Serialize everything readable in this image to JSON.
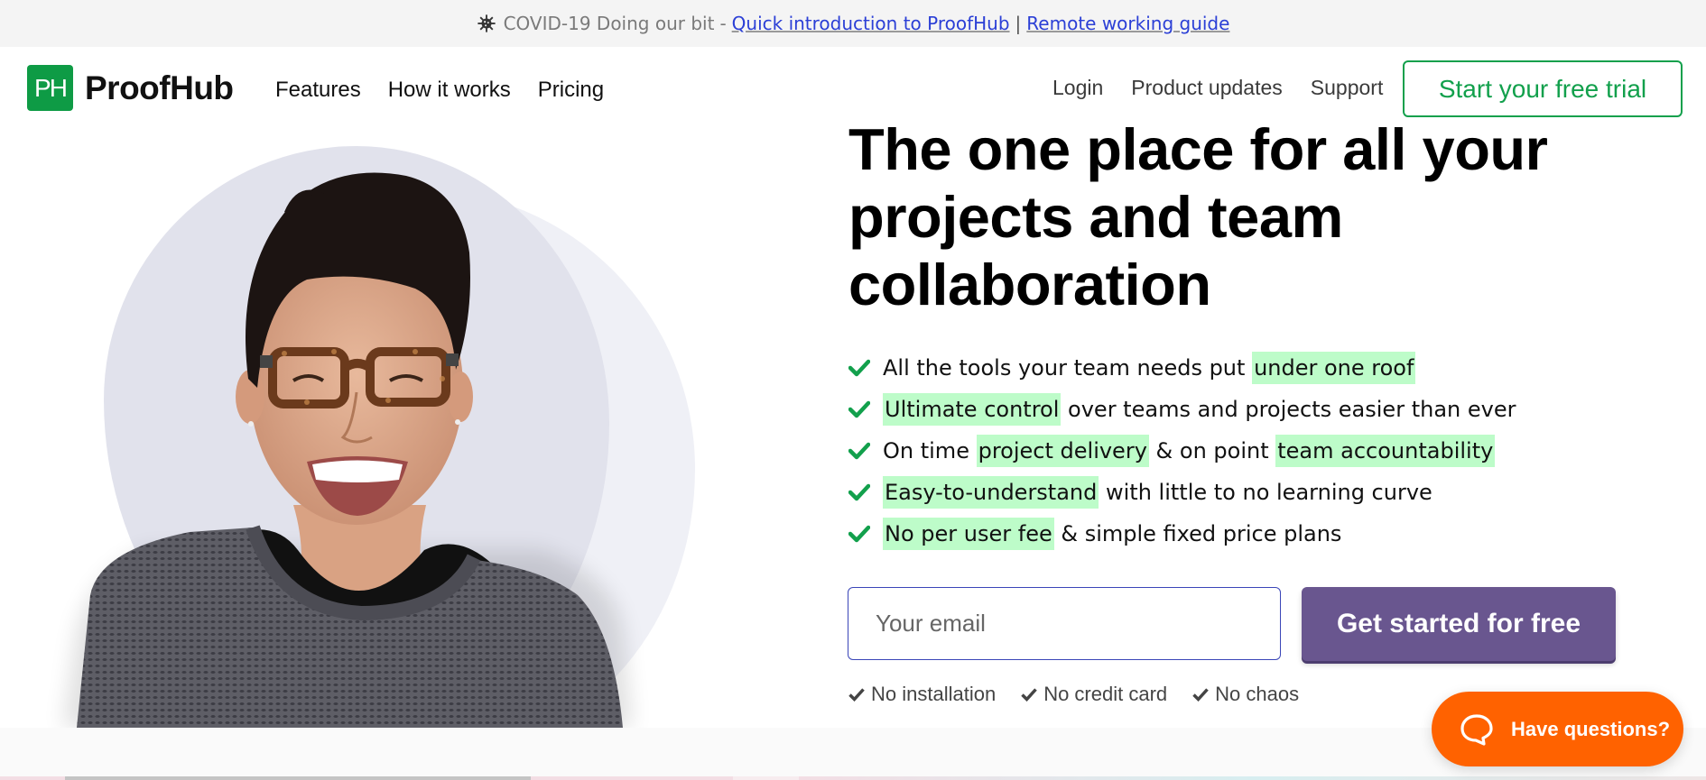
{
  "announcement": {
    "icon": "virus-icon",
    "lead": "COVID-19 Doing our bit",
    "separator_dash": "-",
    "link1": "Quick introduction to ProofHub",
    "separator_pipe": "|",
    "link2": "Remote working guide"
  },
  "header": {
    "logo_mark": "PH",
    "logo_text": "ProofHub",
    "nav_left": [
      {
        "label": "Features"
      },
      {
        "label": "How it works"
      },
      {
        "label": "Pricing"
      }
    ],
    "nav_right": [
      {
        "label": "Login"
      },
      {
        "label": "Product updates"
      },
      {
        "label": "Support"
      }
    ],
    "trial_button": "Start your free trial"
  },
  "hero": {
    "headline_lines": [
      "The one place for all your",
      "projects and team",
      "collaboration"
    ],
    "features": [
      {
        "parts": [
          {
            "text": "All the tools your team needs put ",
            "highlight": false
          },
          {
            "text": "under one roof",
            "highlight": true
          }
        ]
      },
      {
        "parts": [
          {
            "text": "Ultimate control",
            "highlight": true
          },
          {
            "text": " over teams and projects easier than ever",
            "highlight": false
          }
        ]
      },
      {
        "parts": [
          {
            "text": "On time ",
            "highlight": false
          },
          {
            "text": "project delivery",
            "highlight": true
          },
          {
            "text": " & on point ",
            "highlight": false
          },
          {
            "text": "team accountability",
            "highlight": true
          }
        ]
      },
      {
        "parts": [
          {
            "text": "Easy-to-understand",
            "highlight": true
          },
          {
            "text": " with little to no learning curve",
            "highlight": false
          }
        ]
      },
      {
        "parts": [
          {
            "text": "No per user fee",
            "highlight": true
          },
          {
            "text": " & simple fixed price plans",
            "highlight": false
          }
        ]
      }
    ],
    "email_placeholder": "Your email",
    "email_value": "",
    "cta_button": "Get started for free",
    "perks": [
      "No installation",
      "No credit card",
      "No chaos"
    ]
  },
  "chat_widget": {
    "label": "Have questions?",
    "icon": "chat-bubble-icon"
  },
  "colors": {
    "brand_green": "#0e9b45",
    "trial_green": "#12a04c",
    "highlight": "#bdfcc9",
    "cta_purple": "#69568f",
    "chat_orange": "#ff6200",
    "link_blue": "#2b3fd6"
  }
}
